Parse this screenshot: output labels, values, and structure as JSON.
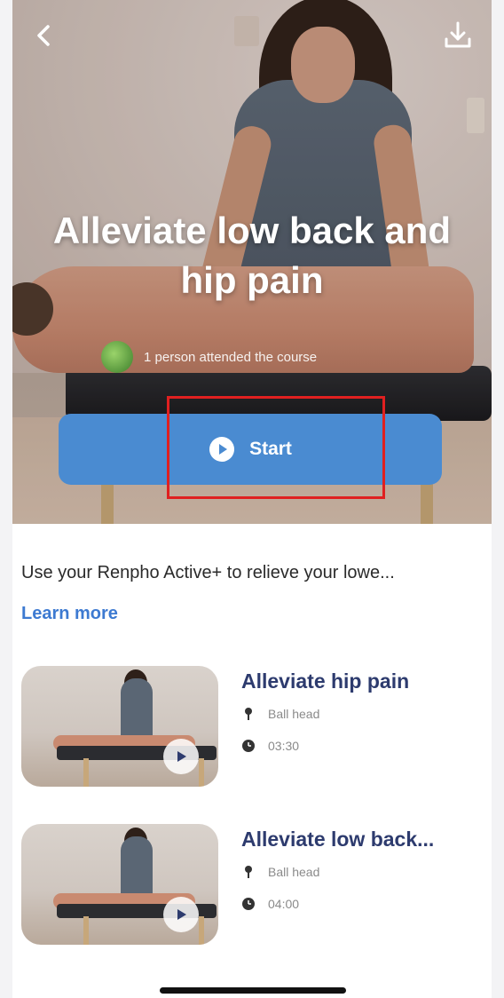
{
  "hero": {
    "title": "Alleviate low back and hip pain",
    "attended_text": "1 person attended the course",
    "start_label": "Start",
    "back_icon": "chevron-left-icon",
    "download_icon": "download-icon"
  },
  "course": {
    "description": "Use your Renpho Active+ to relieve your lowe...",
    "learn_more_label": "Learn more"
  },
  "lessons": [
    {
      "title": "Alleviate hip pain",
      "attachment": "Ball head",
      "duration": "03:30"
    },
    {
      "title": "Alleviate low back...",
      "attachment": "Ball head",
      "duration": "04:00"
    }
  ],
  "colors": {
    "accent": "#4a8bd1",
    "lesson_title": "#2d3b6e",
    "link": "#3d7ad1",
    "highlight": "#e02020"
  }
}
